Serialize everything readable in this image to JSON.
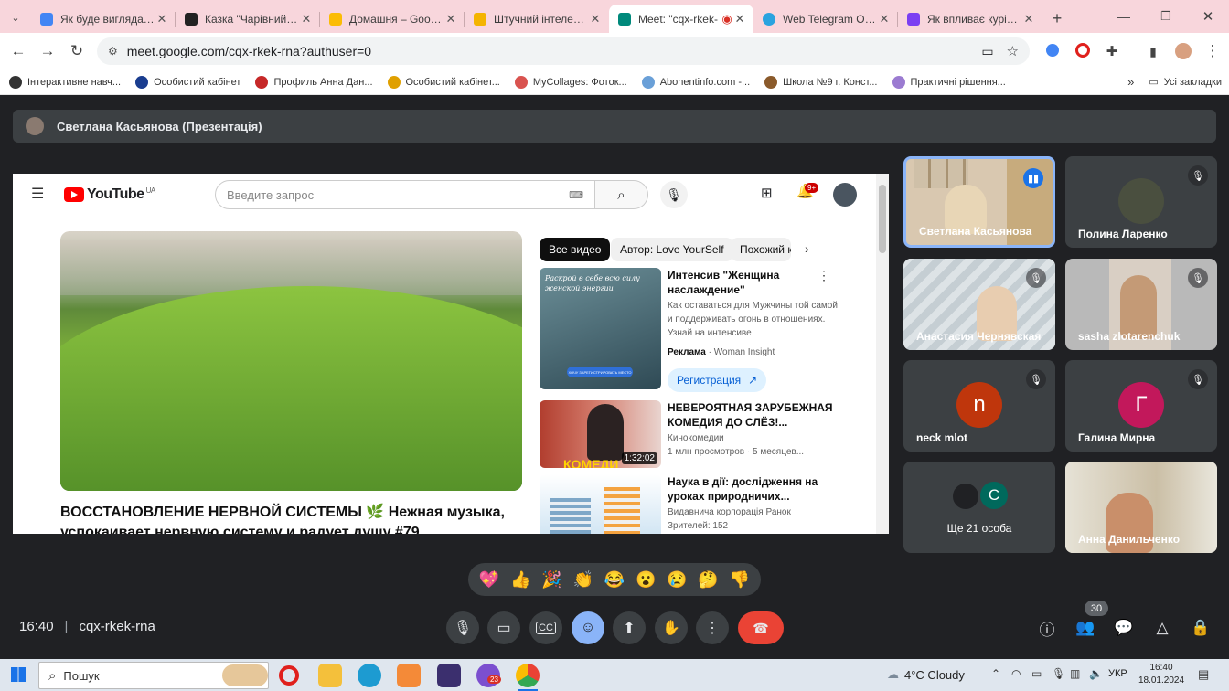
{
  "browser": {
    "tabs": [
      {
        "title": "Як буде виглядати с",
        "fav": "#4285f4"
      },
      {
        "title": "Казка \"Чарівний ліс",
        "fav": "#222"
      },
      {
        "title": "Домашня – Google",
        "fav": "#fbbc04"
      },
      {
        "title": "Штучний інтелект.р",
        "fav": "#f4b400"
      },
      {
        "title": "Meet: \"cqx-rkek-",
        "fav": "#00897b"
      },
      {
        "title": "Web Telegram Onlin",
        "fav": "#2aa3df"
      },
      {
        "title": "Як впливає куріння",
        "fav": "#7b3ff2"
      }
    ],
    "url": "meet.google.com/cqx-rkek-rna?authuser=0",
    "bookmarks": [
      {
        "label": "Інтерактивне навч...",
        "color": "#333"
      },
      {
        "label": "Особистий кабінет",
        "color": "#1a3d8f"
      },
      {
        "label": "Профиль Анна Дан...",
        "color": "#c62828"
      },
      {
        "label": "Особистий кабінет...",
        "color": "#e0a000"
      },
      {
        "label": "MyCollages: Фоток...",
        "color": "#d9534f"
      },
      {
        "label": "Abonentinfo.com -...",
        "color": "#6aa0d8"
      },
      {
        "label": "Школа №9 г. Конст...",
        "color": "#8a5a2b"
      },
      {
        "label": "Практичні рішення...",
        "color": "#9b7bd1"
      }
    ],
    "all_bookmarks": "Усі закладки"
  },
  "meet": {
    "presenter_bar": "Светлана Касьянова (Презентація)",
    "youtube": {
      "logo": "YouTube",
      "region": "UA",
      "search_placeholder": "Введите запрос",
      "notif_badge": "9+",
      "video_title": "ВОССТАНОВЛЕНИЕ НЕРВНОЙ СИСТЕМЫ 🌿 Нежная музыка, успокаивает нервную систему и радует душу #79",
      "chips": [
        "Все видео",
        "Автор: Love YourSelf",
        "Похожий к"
      ],
      "recs": [
        {
          "title": "Интенсив \"Женщина наслаждение\"",
          "desc": "Как оставаться для Мужчины той самой и поддерживать огонь в отношениях. Узнай на интенсиве",
          "ad_label": "Реклама",
          "ad_source": "· Woman Insight",
          "cta": "Регистрация",
          "thumb_text": "Раскрой в себе всю силу женской энергии",
          "thumb_btn": "ХОЧУ ЗАРЕГИСТРИРОВАТЬ МЕСТО"
        },
        {
          "title": "НЕВЕРОЯТНАЯ ЗАРУБЕЖНАЯ КОМЕДИЯ ДО СЛЁЗ!...",
          "channel": "Кинокомедии",
          "meta": "1 млн просмотров · 5 месяцев...",
          "duration": "1:32:02",
          "thumb_text": "КОМЕДИ"
        },
        {
          "title": "Наука в дії: дослідження на уроках природничих...",
          "channel": "Видавнича корпорація Ранок",
          "meta": "Зрителей: 152"
        }
      ]
    },
    "participants": [
      {
        "name": "Светлана Касьянова",
        "speaking": true
      },
      {
        "name": "Полина Ларенко"
      },
      {
        "name": "Анастасия Чернявская"
      },
      {
        "name": "sasha zlotarenchuk"
      },
      {
        "name": "neck mlot",
        "initial": "n",
        "color": "#bf360c"
      },
      {
        "name": "Галина Мирна",
        "initial": "Г",
        "color": "#c2185b"
      },
      {
        "name": "Ще 21 особа",
        "initial": "C",
        "color": "#00695c"
      },
      {
        "name": "Анна Данильченко"
      }
    ],
    "reactions": [
      "💖",
      "👍",
      "🎉",
      "👏",
      "😂",
      "😮",
      "😢",
      "🤔",
      "👎"
    ],
    "time": "16:40",
    "meeting_code": "cqx-rkek-rna",
    "people_count": "30"
  },
  "taskbar": {
    "search": "Пошук",
    "weather": "4°C  Cloudy",
    "lang": "УКР",
    "time": "16:40",
    "date": "18.01.2024",
    "viber_badge": "23"
  }
}
